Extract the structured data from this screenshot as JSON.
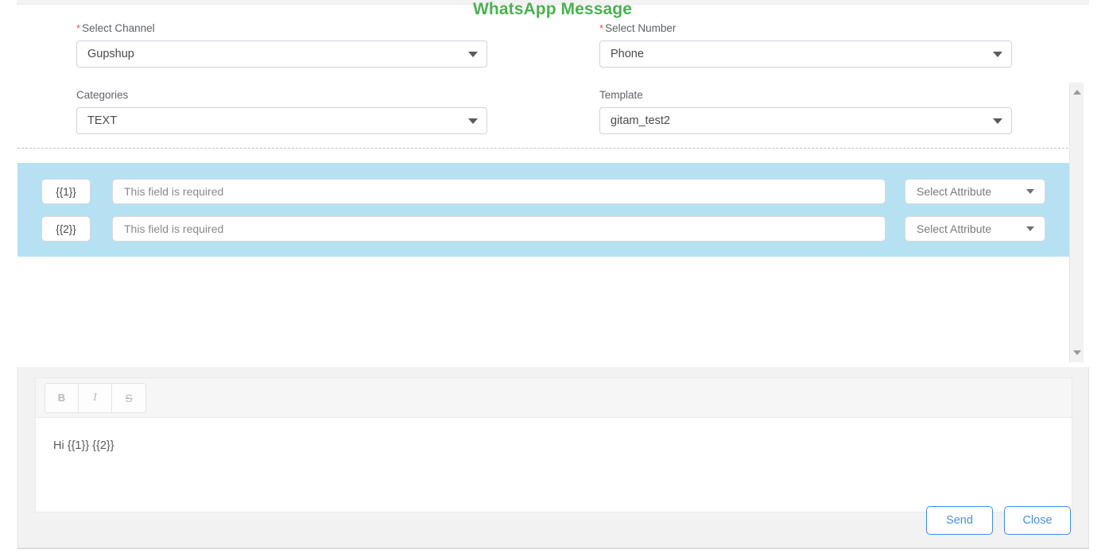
{
  "modal": {
    "title": "WhatsApp Message",
    "title_color": "#4cb050"
  },
  "form": {
    "fields": [
      {
        "label": "Select Channel",
        "required": true,
        "value": "Gupshup",
        "icon": "chevron-down-icon"
      },
      {
        "label": "Select Number",
        "required": true,
        "value": "Phone",
        "icon": "chevron-down-icon"
      },
      {
        "label": "Categories",
        "required": false,
        "value": "TEXT",
        "icon": "chevron-down-icon"
      },
      {
        "label": "Template",
        "required": false,
        "value": "gitam_test2",
        "icon": "chevron-down-icon"
      }
    ],
    "required_marker": "*"
  },
  "variables": {
    "panel_color": "#b5e1f2",
    "rows": [
      {
        "token": "{{1}}",
        "placeholder": "This field is required",
        "value": "",
        "attribute_label": "Select Attribute"
      },
      {
        "token": "{{2}}",
        "placeholder": "This field is required",
        "value": "",
        "attribute_label": "Select Attribute"
      }
    ]
  },
  "scrollbar": {
    "up_icon": "scroll-up-arrow-icon",
    "down_icon": "scroll-down-arrow-icon"
  },
  "editor": {
    "toolbar": [
      {
        "name": "bold-button",
        "label": "B"
      },
      {
        "name": "italic-button",
        "label": "I"
      },
      {
        "name": "strikethrough-button",
        "label": "S"
      }
    ],
    "body_text": "Hi {{1}} {{2}}"
  },
  "actions": {
    "send_label": "Send",
    "close_label": "Close",
    "accent_color": "#4a90e2"
  }
}
